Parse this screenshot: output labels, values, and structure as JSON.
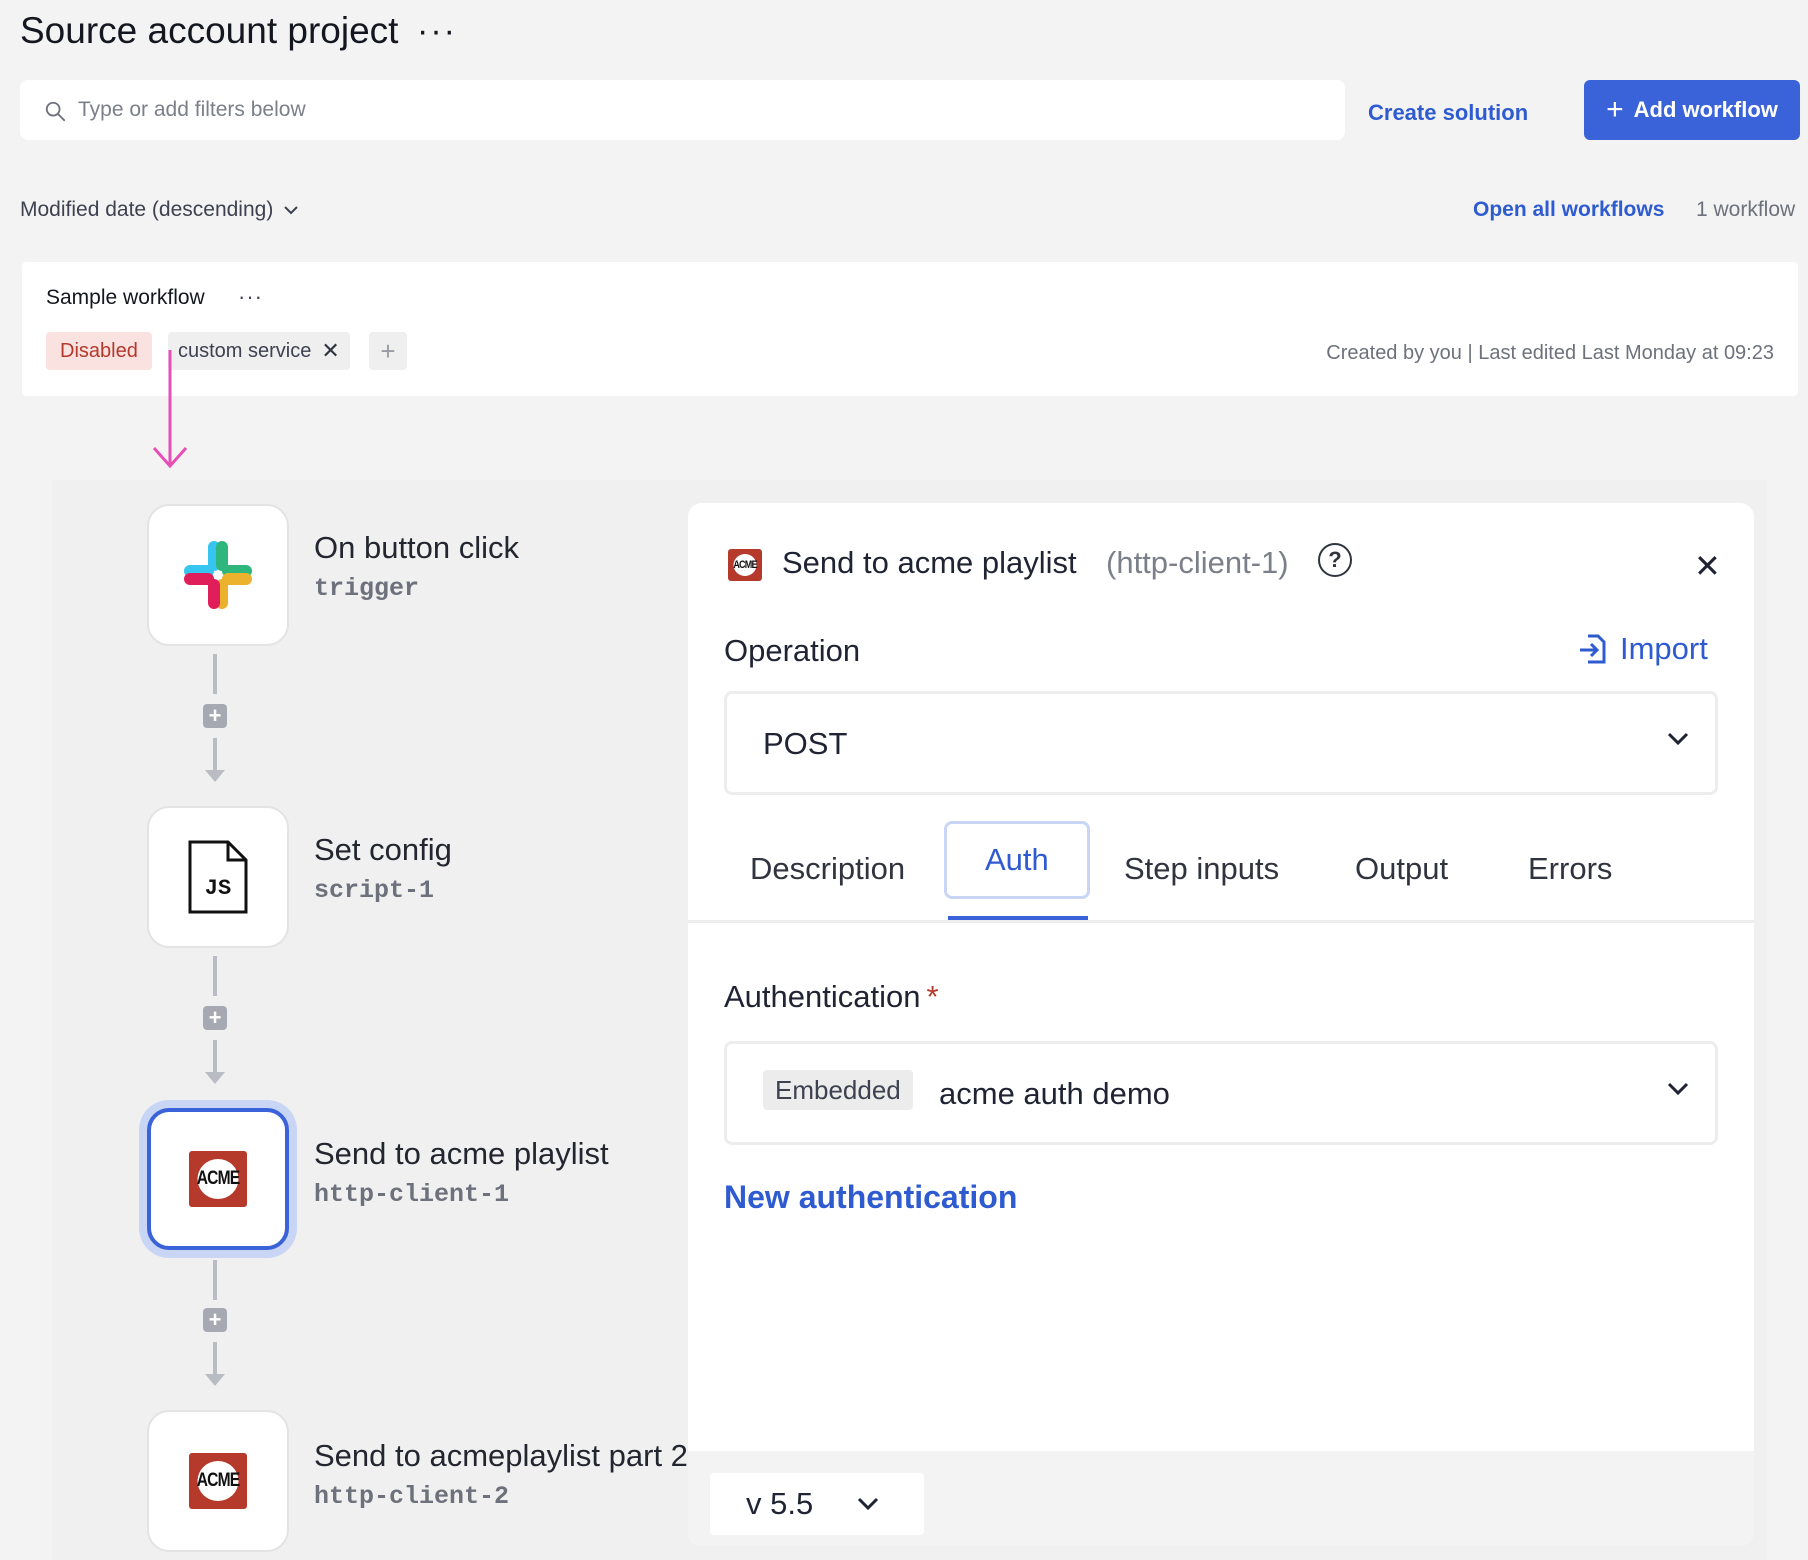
{
  "header": {
    "title": "Source account project",
    "menu_dots": "···"
  },
  "search": {
    "placeholder": "Type or add filters below",
    "value": ""
  },
  "actions": {
    "create_solution": "Create solution",
    "add_workflow": "Add workflow"
  },
  "list_bar": {
    "sort_label": "Modified date (descending)",
    "open_all": "Open all workflows",
    "count": "1 workflow"
  },
  "workflow_card": {
    "name": "Sample workflow",
    "menu_dots": "···",
    "status_badge": "Disabled",
    "tag": "custom service",
    "tag_remove": "✕",
    "add_tag": "+",
    "meta": "Created by you | Last edited Last Monday at 09:23"
  },
  "steps": [
    {
      "title": "On button click",
      "subtitle": "trigger",
      "icon": "slack-icon"
    },
    {
      "title": "Set config",
      "subtitle": "script-1",
      "icon": "js-file-icon",
      "icon_text": "JS"
    },
    {
      "title": "Send to acme playlist",
      "subtitle": "http-client-1",
      "icon": "acme-logo",
      "selected": true
    },
    {
      "title": "Send to acmeplaylist part 2",
      "subtitle": "http-client-2",
      "icon": "acme-logo"
    }
  ],
  "acme_logo_text": "ACME",
  "panel": {
    "title": "Send to acme playlist",
    "id": "(http-client-1)",
    "help": "?",
    "close": "✕",
    "operation_label": "Operation",
    "import_label": "Import",
    "operation_value": "POST",
    "tabs": [
      "Description",
      "Auth",
      "Step inputs",
      "Output",
      "Errors"
    ],
    "active_tab": "Auth",
    "auth_label": "Authentication",
    "required_mark": "*",
    "auth_badge": "Embedded",
    "auth_value": "acme auth demo",
    "new_auth": "New authentication",
    "version": "v 5.5"
  },
  "colors": {
    "accent": "#3b63d9",
    "link": "#2f5bd0",
    "danger": "#b5382c",
    "annotation_arrow": "#e64fb6"
  }
}
